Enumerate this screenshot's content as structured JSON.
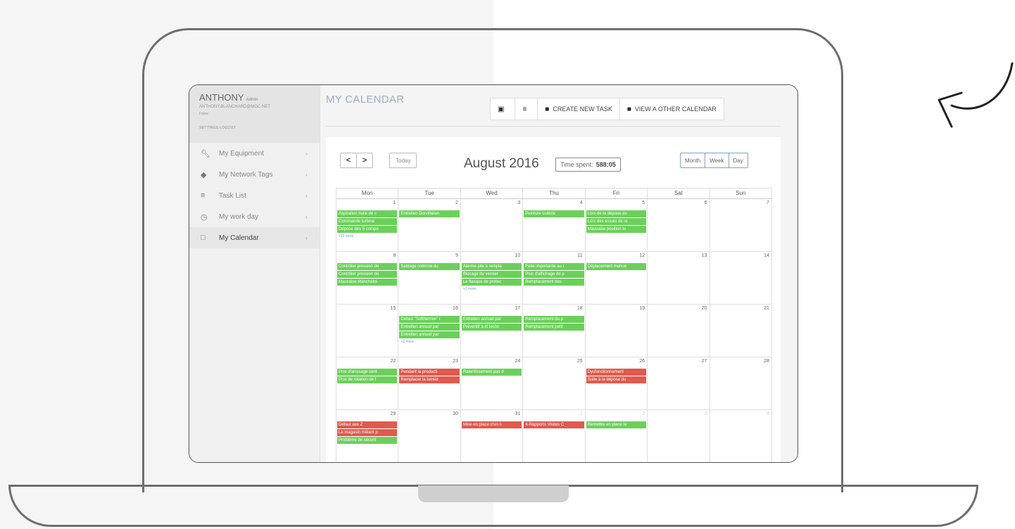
{
  "sidebar": {
    "profile": {
      "name": "ANTHONY",
      "role": "Admin",
      "email": "ANTHONY.BLANCHARD@MGC.NET",
      "extra": "Fabre",
      "links": "SETTINGS LOGOUT"
    },
    "items": [
      {
        "label": "My Equipment",
        "icon": "wrench-icon"
      },
      {
        "label": "My Network Tags",
        "icon": "tag-icon"
      },
      {
        "label": "Task List",
        "icon": "list-icon"
      },
      {
        "label": "My work day",
        "icon": "clock-icon"
      },
      {
        "label": "My Calendar",
        "icon": "calendar-icon",
        "active": true
      }
    ]
  },
  "header": {
    "title": "MY CALENDAR",
    "buttons": {
      "calendar_icon": "calendar-view-icon",
      "list_icon": "list-view-icon",
      "create": "CREATE NEW TASK",
      "view_other": "VIEW A OTHER CALENDAR"
    }
  },
  "calendar": {
    "prev": "<",
    "next": ">",
    "today": "Today",
    "month_label": "August 2016",
    "time_spent_label": "Time spent:",
    "time_spent_value": "588:05",
    "views": [
      "Month",
      "Week",
      "Day"
    ],
    "day_headers": [
      "Mon",
      "Tue",
      "Wed",
      "Thu",
      "Fri",
      "Sat",
      "Sun"
    ],
    "weeks": [
      {
        "days": [
          {
            "num": "1",
            "events": [
              {
                "t": "Aspiration huile de c",
                "c": "g"
              },
              {
                "t": "Commande turbine",
                "c": "g"
              },
              {
                "t": "Dépose des 5 compo",
                "c": "g"
              }
            ],
            "more": "+31 more"
          },
          {
            "num": "2",
            "events": [
              {
                "t": "Entretien Dorvillalion",
                "c": "g"
              }
            ]
          },
          {
            "num": "3",
            "events": []
          },
          {
            "num": "4",
            "events": [
              {
                "t": "Peinture cubicle",
                "c": "g"
              }
            ]
          },
          {
            "num": "5",
            "events": [
              {
                "t": "Lors de la dépose du",
                "c": "g"
              },
              {
                "t": "Lors des essais de re",
                "c": "g"
              },
              {
                "t": "Mauvaise position lo",
                "c": "g"
              }
            ]
          },
          {
            "num": "6",
            "events": []
          },
          {
            "num": "7",
            "events": []
          }
        ]
      },
      {
        "days": [
          {
            "num": "8",
            "events": [
              {
                "t": "Contrôler pression de",
                "c": "g"
              },
              {
                "t": "Contrôler pression de",
                "c": "g"
              },
              {
                "t": "Mauvaise étanchéité",
                "c": "g"
              }
            ]
          },
          {
            "num": "9",
            "events": [
              {
                "t": "Sablage colonne du",
                "c": "g"
              }
            ]
          },
          {
            "num": "10",
            "events": [
              {
                "t": "Alarme pile à rempla",
                "c": "g"
              },
              {
                "t": "Blocage du vernier",
                "c": "g"
              },
              {
                "t": "Le flasque de protec",
                "c": "g"
              }
            ],
            "more": "+2 more"
          },
          {
            "num": "11",
            "events": [
              {
                "t": "Fuite importante au r",
                "c": "g"
              },
              {
                "t": "Plus d'affichage de p",
                "c": "g"
              },
              {
                "t": "Remplacement des",
                "c": "g"
              }
            ]
          },
          {
            "num": "12",
            "events": [
              {
                "t": "Déplacement manue",
                "c": "g"
              }
            ]
          },
          {
            "num": "13",
            "events": []
          },
          {
            "num": "14",
            "events": []
          }
        ]
      },
      {
        "days": [
          {
            "num": "15",
            "events": []
          },
          {
            "num": "16",
            "events": [
              {
                "t": "Défaut \"Softhermie\" r",
                "c": "g"
              },
              {
                "t": "Entretien annuel par",
                "c": "g"
              },
              {
                "t": "Entretien annuel par",
                "c": "g"
              }
            ],
            "more": "+2 more"
          },
          {
            "num": "17",
            "events": [
              {
                "t": "Entretien annuel par",
                "c": "g"
              },
              {
                "t": "Préventif à-lit techn",
                "c": "g"
              }
            ]
          },
          {
            "num": "18",
            "events": [
              {
                "t": "Remplacement du p",
                "c": "g"
              },
              {
                "t": "Remplacement petit",
                "c": "g"
              }
            ]
          },
          {
            "num": "19",
            "events": []
          },
          {
            "num": "20",
            "events": []
          },
          {
            "num": "21",
            "events": []
          }
        ]
      },
      {
        "days": [
          {
            "num": "22",
            "events": [
              {
                "t": "Plus d'arrosage cent",
                "c": "g"
              },
              {
                "t": "Plus de rotation de l",
                "c": "g"
              }
            ]
          },
          {
            "num": "23",
            "events": [
              {
                "t": "Pendant la producti",
                "c": "r"
              },
              {
                "t": "Remplacer la lumièr",
                "c": "r"
              }
            ]
          },
          {
            "num": "24",
            "events": [
              {
                "t": "Ralentissement pas d",
                "c": "g"
              }
            ]
          },
          {
            "num": "25",
            "events": []
          },
          {
            "num": "26",
            "events": [
              {
                "t": "Dysfonctionnement",
                "c": "r"
              },
              {
                "t": "Suite à la dépose du",
                "c": "r"
              }
            ]
          },
          {
            "num": "27",
            "events": []
          },
          {
            "num": "28",
            "events": []
          }
        ]
      },
      {
        "days": [
          {
            "num": "29",
            "events": [
              {
                "t": "Défaut axe Z",
                "c": "r"
              },
              {
                "t": "Le magasin mêlant p",
                "c": "r"
              },
              {
                "t": "Problème de sécurit",
                "c": "g"
              }
            ]
          },
          {
            "num": "30",
            "events": []
          },
          {
            "num": "31",
            "events": [
              {
                "t": "Mise en place d'un n",
                "c": "r"
              }
            ]
          },
          {
            "num": "1",
            "other": true,
            "events": [
              {
                "t": "4-Rapports Visites C",
                "c": "r"
              }
            ]
          },
          {
            "num": "2",
            "other": true,
            "events": [
              {
                "t": "Remettre en place la",
                "c": "g"
              }
            ]
          },
          {
            "num": "3",
            "other": true,
            "events": []
          },
          {
            "num": "4",
            "other": true,
            "events": []
          }
        ]
      }
    ]
  }
}
